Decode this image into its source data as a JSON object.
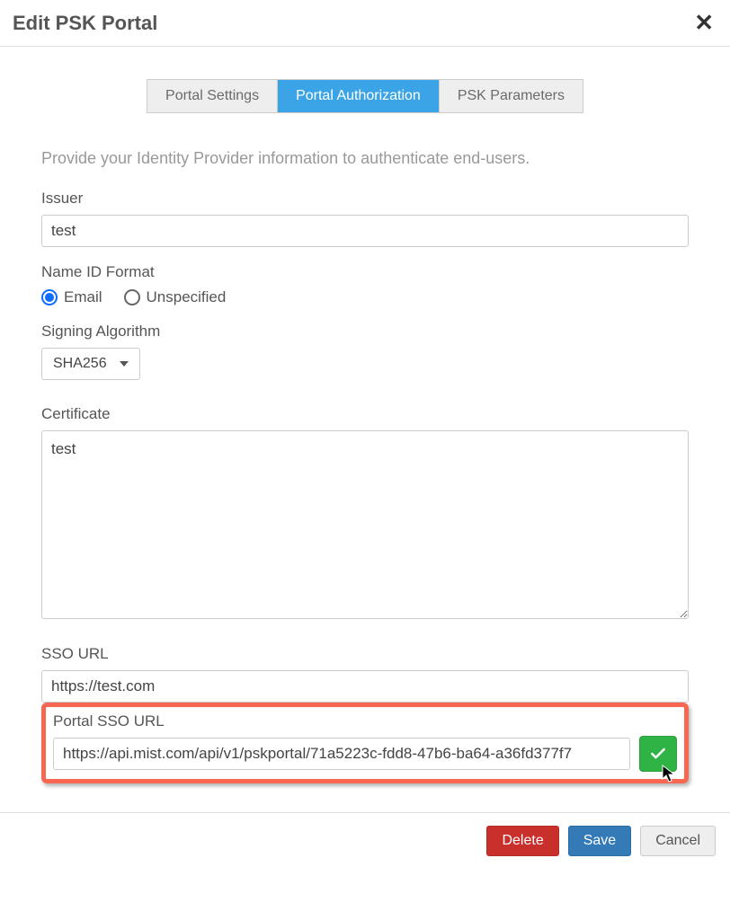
{
  "header": {
    "title": "Edit PSK Portal"
  },
  "tabs": [
    {
      "label": "Portal Settings",
      "active": false
    },
    {
      "label": "Portal Authorization",
      "active": true
    },
    {
      "label": "PSK Parameters",
      "active": false
    }
  ],
  "help_text": "Provide your Identity Provider information to authenticate end-users.",
  "fields": {
    "issuer": {
      "label": "Issuer",
      "value": "test"
    },
    "name_id": {
      "label": "Name ID Format",
      "options": {
        "email": "Email",
        "unspecified": "Unspecified"
      },
      "selected": "email"
    },
    "signing_algo": {
      "label": "Signing Algorithm",
      "value": "SHA256"
    },
    "certificate": {
      "label": "Certificate",
      "value": "test"
    },
    "sso_url": {
      "label": "SSO URL",
      "value": "https://test.com"
    },
    "portal_sso_url": {
      "label": "Portal SSO URL",
      "value": "https://api.mist.com/api/v1/pskportal/71a5223c-fdd8-47b6-ba64-a36fd377f7"
    }
  },
  "footer": {
    "delete": "Delete",
    "save": "Save",
    "cancel": "Cancel"
  }
}
